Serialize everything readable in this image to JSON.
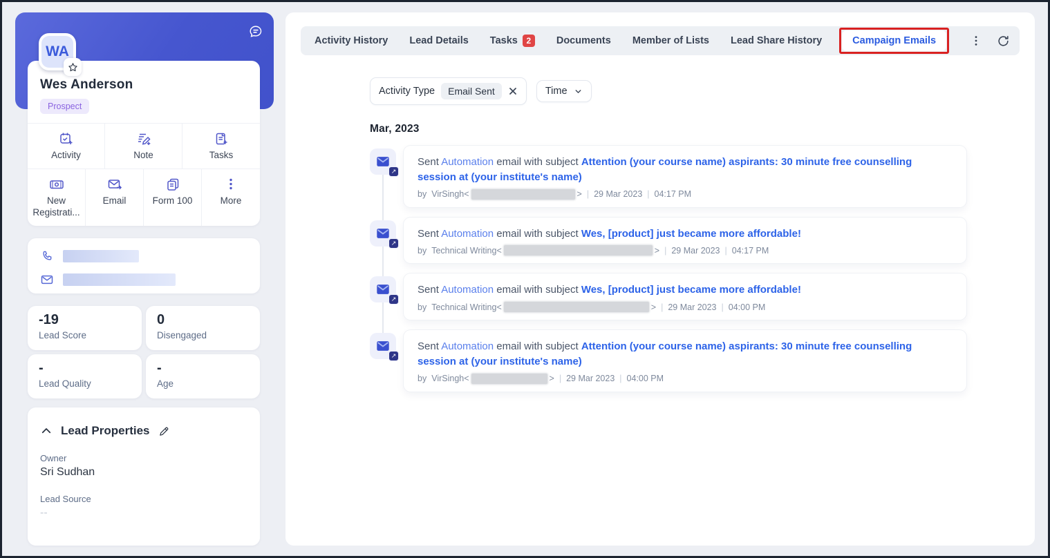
{
  "sidebar": {
    "avatar_initials": "WA",
    "name": "Wes Anderson",
    "stage_badge": "Prospect",
    "actions_row1": [
      {
        "label": "Activity",
        "icon": "activity-calendar-plus-icon"
      },
      {
        "label": "Note",
        "icon": "note-plus-icon"
      },
      {
        "label": "Tasks",
        "icon": "clipboard-plus-icon"
      }
    ],
    "actions_row2": [
      {
        "label": "New Registrati...",
        "icon": "banknote-icon"
      },
      {
        "label": "Email",
        "icon": "email-send-icon"
      },
      {
        "label": "Form 100",
        "icon": "forms-copy-icon"
      },
      {
        "label": "More",
        "icon": "kebab-icon"
      }
    ],
    "contact": {
      "phone_redacted": true,
      "email_redacted": true
    },
    "metrics": [
      {
        "value": "-19",
        "label": "Lead Score"
      },
      {
        "value": "0",
        "label": "Disengaged"
      },
      {
        "value": "-",
        "label": "Lead Quality"
      },
      {
        "value": "-",
        "label": "Age"
      }
    ],
    "properties": {
      "title": "Lead Properties",
      "fields": [
        {
          "label": "Owner",
          "value": "Sri Sudhan"
        },
        {
          "label": "Lead Source",
          "value": "--"
        }
      ]
    }
  },
  "tabs": {
    "items": [
      "Activity History",
      "Lead Details",
      "Tasks",
      "Documents",
      "Member of Lists",
      "Lead Share History",
      "Campaign Emails"
    ],
    "tasks_badge": "2",
    "active": "Campaign Emails"
  },
  "filters": {
    "activity_type_label": "Activity Type",
    "activity_type_value": "Email Sent",
    "time_label": "Time"
  },
  "timeline": {
    "month": "Mar, 2023",
    "sep": "|",
    "entries": [
      {
        "prefix": "Sent",
        "link": "Automation",
        "middle": "email with subject",
        "subject": "Attention (your course name) aspirants: 30 minute free counselling session at (your institute's name)",
        "by": "by",
        "sender": "VirSingh<",
        "sender_close": ">",
        "date": "29 Mar 2023",
        "time": "04:17 PM"
      },
      {
        "prefix": "Sent",
        "link": "Automation",
        "middle": "email with subject",
        "subject": "Wes, [product] just became more affordable!",
        "by": "by",
        "sender": "Technical Writing<",
        "sender_close": ">",
        "date": "29 Mar 2023",
        "time": "04:17 PM"
      },
      {
        "prefix": "Sent",
        "link": "Automation",
        "middle": "email with subject",
        "subject": "Wes, [product] just became more affordable!",
        "by": "by",
        "sender": "Technical Writing<",
        "sender_close": ">",
        "date": "29 Mar 2023",
        "time": "04:00 PM"
      },
      {
        "prefix": "Sent",
        "link": "Automation",
        "middle": "email with subject",
        "subject": "Attention (your course name) aspirants: 30 minute free counselling session at (your institute's name)",
        "by": "by",
        "sender": "VirSingh<",
        "sender_close": ">",
        "date": "29 Mar 2023",
        "time": "04:00 PM"
      }
    ]
  },
  "colors": {
    "header_blue": "#4b5ad4",
    "accent_blue": "#2d63e8",
    "link_blue": "#5b80ec",
    "tab_active_blue": "#2b5ce0",
    "tasks_badge_red": "#e04545",
    "annotation_red": "#d92121",
    "prospect_purple": "#8a63e0",
    "icon_indigo": "#5157c9"
  }
}
